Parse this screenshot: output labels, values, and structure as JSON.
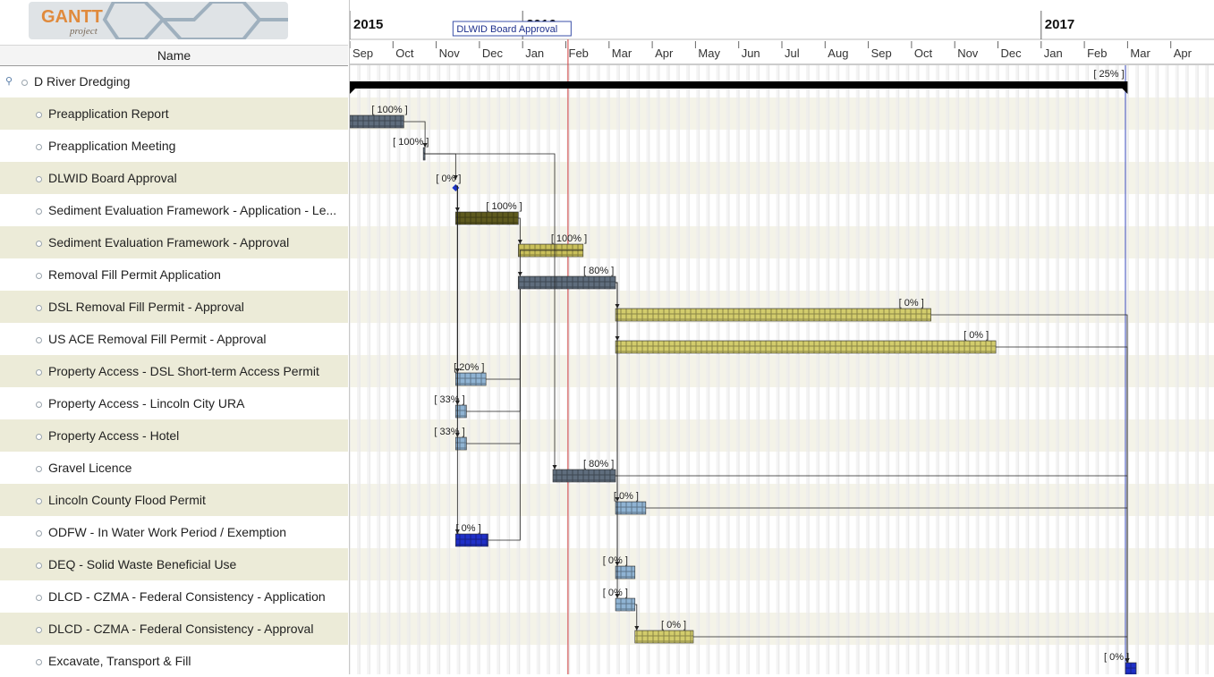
{
  "app": {
    "logo_text": "GANTT",
    "logo_subtext": "project"
  },
  "columns": {
    "name": "Name"
  },
  "timeline": {
    "years": [
      {
        "label": "2015",
        "month_index": 0
      },
      {
        "label": "2016",
        "month_index": 4
      },
      {
        "label": "2017",
        "month_index": 16
      }
    ],
    "months": [
      "Sep",
      "Oct",
      "Nov",
      "Dec",
      "Jan",
      "Feb",
      "Mar",
      "Apr",
      "May",
      "Jun",
      "Jul",
      "Aug",
      "Sep",
      "Oct",
      "Nov",
      "Dec",
      "Jan",
      "Feb",
      "Mar",
      "Apr"
    ],
    "milestone_label": "DLWID Board Approval",
    "today_month": 5.05,
    "project_end_month": 17.95
  },
  "tasks": [
    {
      "name": "D River Dredging",
      "summary": true,
      "progress": "[ 25% ]",
      "start": 0,
      "end": 18.0
    },
    {
      "name": "Preapplication Report",
      "progress": "[ 100% ]",
      "start": 0,
      "end": 1.25,
      "color": "#5f6d7d"
    },
    {
      "name": "Preapplication Meeting",
      "progress": "[ 100% ]",
      "start": 1.7,
      "end": 1.72,
      "color": "#5f6d7d"
    },
    {
      "name": "DLWID Board Approval",
      "progress": "[ 0% ]",
      "milestone": true,
      "start": 2.45
    },
    {
      "name": "Sediment Evaluation Framework - Application - Le...",
      "progress": "[ 100% ]",
      "start": 2.45,
      "end": 3.9,
      "color": "#5e5a1e"
    },
    {
      "name": "Sediment Evaluation Framework - Approval",
      "progress": "[ 100% ]",
      "start": 3.9,
      "end": 5.4,
      "color": "#c9c05a"
    },
    {
      "name": "Removal Fill Permit Application",
      "progress": "[ 80% ]",
      "start": 3.9,
      "end": 6.15,
      "color": "#5f6d7d"
    },
    {
      "name": "DSL Removal Fill Permit - Approval",
      "progress": "[ 0% ]",
      "start": 6.15,
      "end": 13.45,
      "color": "#d2cc6c"
    },
    {
      "name": "US ACE Removal Fill Permit  - Approval",
      "progress": "[ 0% ]",
      "start": 6.15,
      "end": 14.95,
      "color": "#d2cc6c"
    },
    {
      "name": "Property Access - DSL  Short-term Access Permit",
      "progress": "[ 20% ]",
      "start": 2.45,
      "end": 3.15,
      "color": "#8fb3d3"
    },
    {
      "name": "Property Access - Lincoln City URA",
      "progress": "[ 33% ]",
      "start": 2.45,
      "end": 2.7,
      "color": "#8fb3d3"
    },
    {
      "name": "Property Access - Hotel",
      "progress": "[ 33% ]",
      "start": 2.45,
      "end": 2.7,
      "color": "#8fb3d3"
    },
    {
      "name": "Gravel Licence",
      "progress": "[ 80% ]",
      "start": 4.7,
      "end": 6.15,
      "color": "#5f6d7d"
    },
    {
      "name": "Lincoln County Flood Permit",
      "progress": "[ 0% ]",
      "start": 6.15,
      "end": 6.85,
      "color": "#8fb3d3"
    },
    {
      "name": "ODFW - In Water Work Period / Exemption",
      "progress": "[ 0% ]",
      "start": 2.45,
      "end": 3.2,
      "color": "#1f2fc8"
    },
    {
      "name": "DEQ - Solid Waste Beneficial Use",
      "progress": "[ 0% ]",
      "start": 6.15,
      "end": 6.6,
      "color": "#8fb3d3"
    },
    {
      "name": "DLCD - CZMA - Federal Consistency - Application",
      "progress": "[ 0% ]",
      "start": 6.15,
      "end": 6.6,
      "color": "#8fb3d3"
    },
    {
      "name": "DLCD - CZMA - Federal Consistency - Approval",
      "progress": "[ 0% ]",
      "start": 6.6,
      "end": 7.95,
      "color": "#d2cc6c"
    },
    {
      "name": "Excavate, Transport & Fill",
      "progress": "[ 0% ]",
      "start": 17.95,
      "end": 18.2,
      "color": "#1f2fc8"
    }
  ]
}
